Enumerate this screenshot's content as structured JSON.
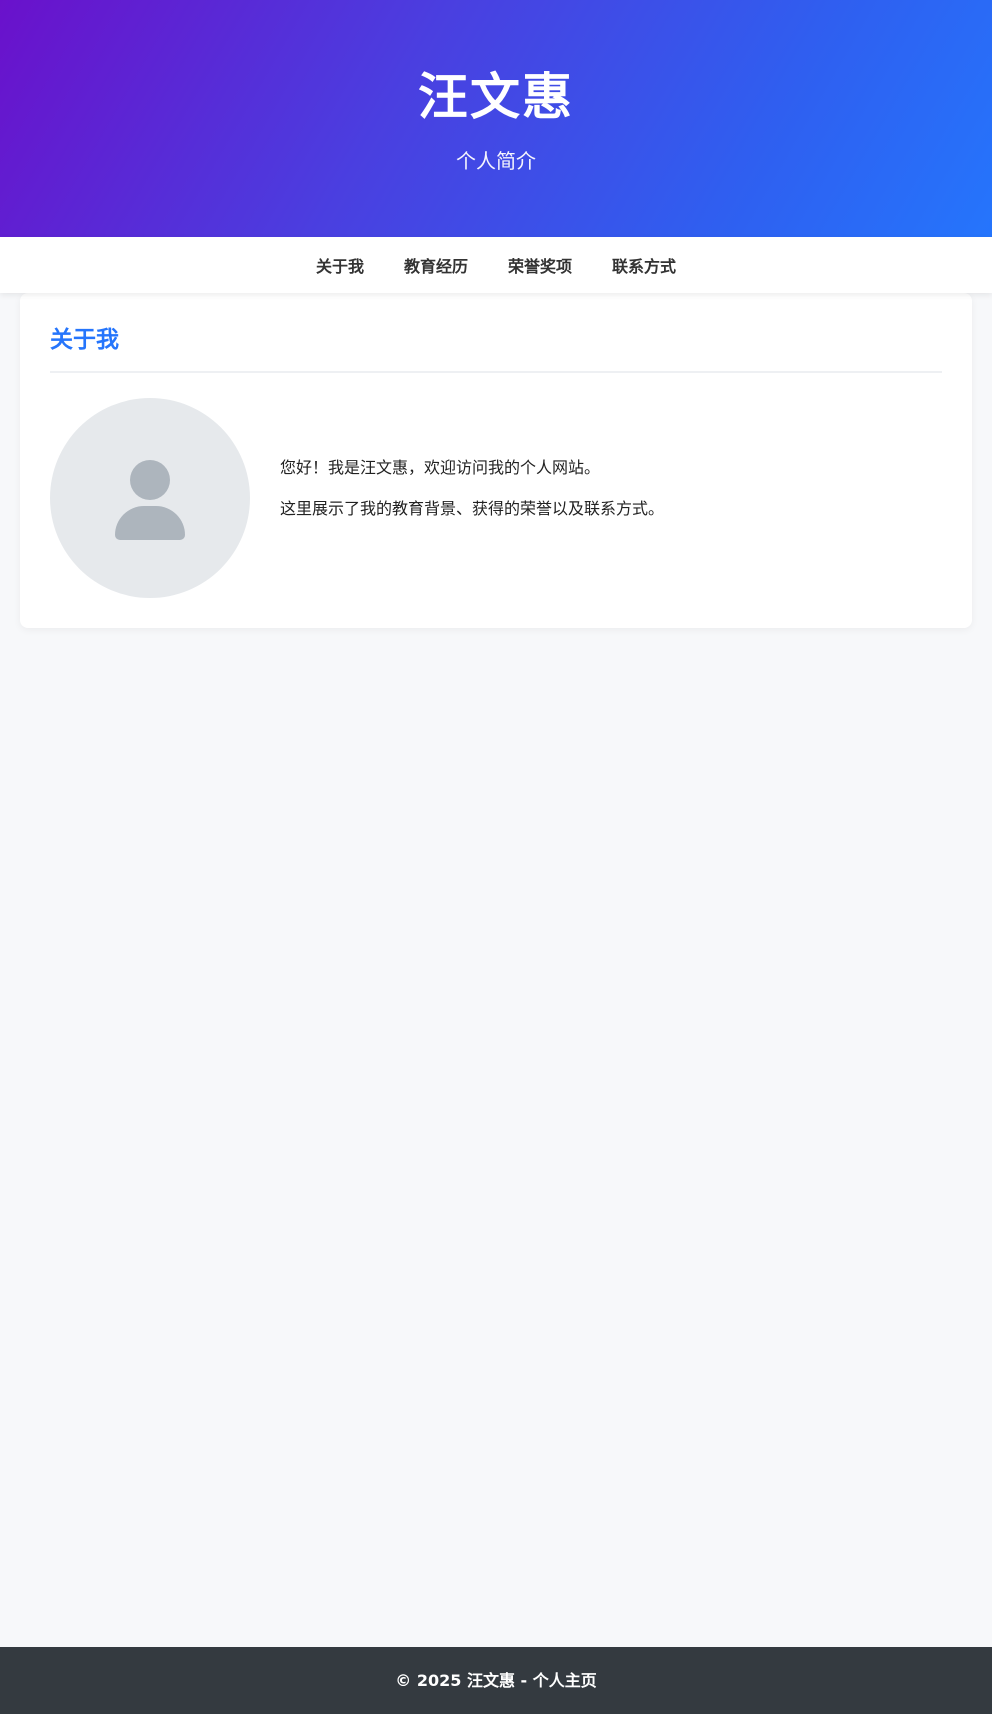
{
  "header": {
    "name": "汪文惠",
    "subtitle": "个人简介"
  },
  "nav": {
    "items": [
      {
        "label": "关于我"
      },
      {
        "label": "教育经历"
      },
      {
        "label": "荣誉奖项"
      },
      {
        "label": "联系方式"
      }
    ]
  },
  "about": {
    "title": "关于我",
    "avatar_icon": "user-placeholder-icon",
    "paragraphs": [
      "您好！我是汪文惠，欢迎访问我的个人网站。",
      "这里展示了我的教育背景、获得的荣誉以及联系方式。"
    ]
  },
  "footer": {
    "text": "© 2025 汪文惠 - 个人主页"
  },
  "colors": {
    "gradient_start": "#6a11cb",
    "gradient_end": "#2575fc",
    "accent": "#2575fc",
    "footer_bg": "#343a40",
    "page_bg": "#f7f8fa"
  }
}
